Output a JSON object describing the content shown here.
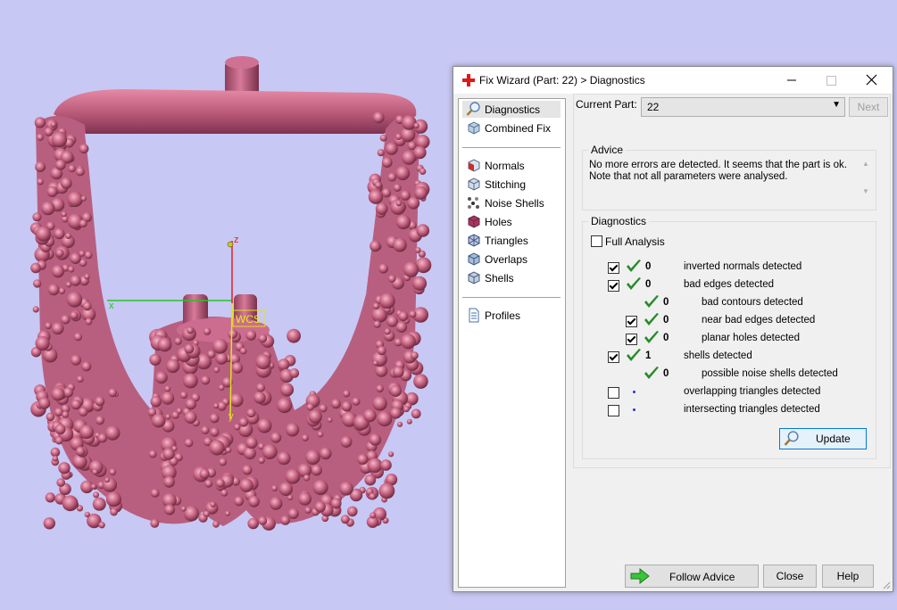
{
  "viewport": {
    "axis_x_label": "x",
    "axis_y_label": "y",
    "axis_z_label": "z",
    "wcs_label": "WCS"
  },
  "dialog": {
    "title": "Fix Wizard (Part: 22) > Diagnostics",
    "nav": {
      "top_items": [
        {
          "label": "Diagnostics",
          "icon": "magnifier-icon"
        },
        {
          "label": "Combined Fix",
          "icon": "cube-icon"
        }
      ],
      "fix_items": [
        {
          "label": "Normals",
          "icon": "normals-icon"
        },
        {
          "label": "Stitching",
          "icon": "stitching-icon"
        },
        {
          "label": "Noise Shells",
          "icon": "noise-shells-icon"
        },
        {
          "label": "Holes",
          "icon": "holes-icon"
        },
        {
          "label": "Triangles",
          "icon": "triangles-icon"
        },
        {
          "label": "Overlaps",
          "icon": "overlaps-icon"
        },
        {
          "label": "Shells",
          "icon": "shells-icon"
        }
      ],
      "profiles": {
        "label": "Profiles",
        "icon": "document-icon"
      }
    },
    "current_part_label": "Current Part:",
    "current_part_value": "22",
    "next_button": "Next",
    "advice": {
      "title": "Advice",
      "line1": "No more errors are detected. It seems that the part is ok.",
      "line2": "Note that not all parameters were analysed."
    },
    "diagnostics": {
      "title": "Diagnostics",
      "full_analysis_label": "Full Analysis",
      "rows": [
        {
          "checkbox": true,
          "checked": true,
          "status": "ok",
          "count": "0",
          "label": "inverted normals detected"
        },
        {
          "checkbox": true,
          "checked": true,
          "status": "ok",
          "count": "0",
          "label": "bad edges detected"
        },
        {
          "checkbox": false,
          "checked": false,
          "status": "ok",
          "count": "0",
          "label": "bad contours detected"
        },
        {
          "checkbox": true,
          "checked": true,
          "status": "ok",
          "count": "0",
          "label": "near bad edges detected"
        },
        {
          "checkbox": true,
          "checked": true,
          "status": "ok",
          "count": "0",
          "label": "planar holes detected"
        },
        {
          "checkbox": true,
          "checked": true,
          "status": "ok",
          "count": "1",
          "label": "shells detected"
        },
        {
          "checkbox": false,
          "checked": false,
          "status": "ok",
          "count": "0",
          "label": "possible noise shells detected"
        },
        {
          "checkbox": true,
          "checked": false,
          "status": "none",
          "count": "",
          "label": "overlapping triangles detected"
        },
        {
          "checkbox": true,
          "checked": false,
          "status": "none",
          "count": "",
          "label": "intersecting triangles detected"
        }
      ],
      "update_button": "Update"
    },
    "follow_advice_button": "Follow Advice",
    "close_button": "Close",
    "help_button": "Help"
  },
  "colors": {
    "background": "#c8c8f4",
    "model": "#c86a8c",
    "check_green": "#2a8a2a",
    "accent_blue": "#0078d7"
  }
}
